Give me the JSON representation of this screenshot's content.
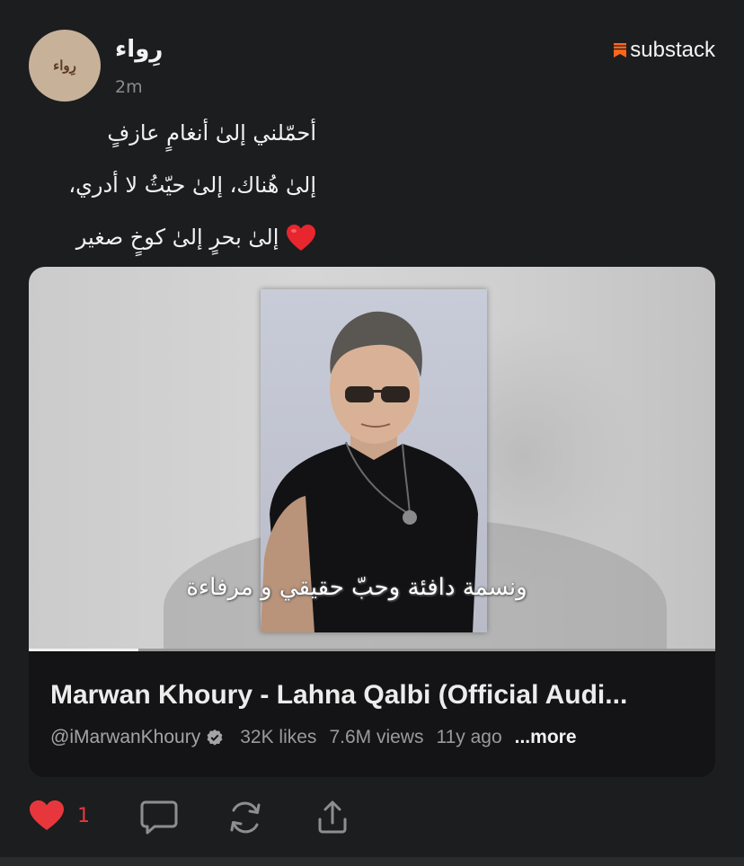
{
  "post": {
    "avatar_text": "رِواء",
    "author": "رِواء",
    "time": "2m",
    "brand": "substack",
    "lines": [
      "أحمّلني إلىٰ أنغامٍ عازفٍ",
      "إلىٰ هُناك، إلىٰ حيّثُ لا أدري،",
      "إلىٰ بحرٍ إلىٰ كوخٍ صغير"
    ]
  },
  "video": {
    "caption": "ونسمة دافئة وحبّ حقيقي و مرفاءة",
    "title": "Marwan Khoury - Lahna Qalbi (Official Audi...",
    "channel": "@iMarwanKhoury",
    "likes": "32K likes",
    "views": "7.6M views",
    "age": "11y ago",
    "more": "...more",
    "progress": 0.16
  },
  "actions": {
    "like_count": "1",
    "icons": [
      "heart-icon",
      "comment-icon",
      "restack-icon",
      "share-icon"
    ]
  },
  "colors": {
    "background": "#1c1d1f",
    "accent_red": "#e8373c",
    "substack_orange": "#ff6719"
  }
}
